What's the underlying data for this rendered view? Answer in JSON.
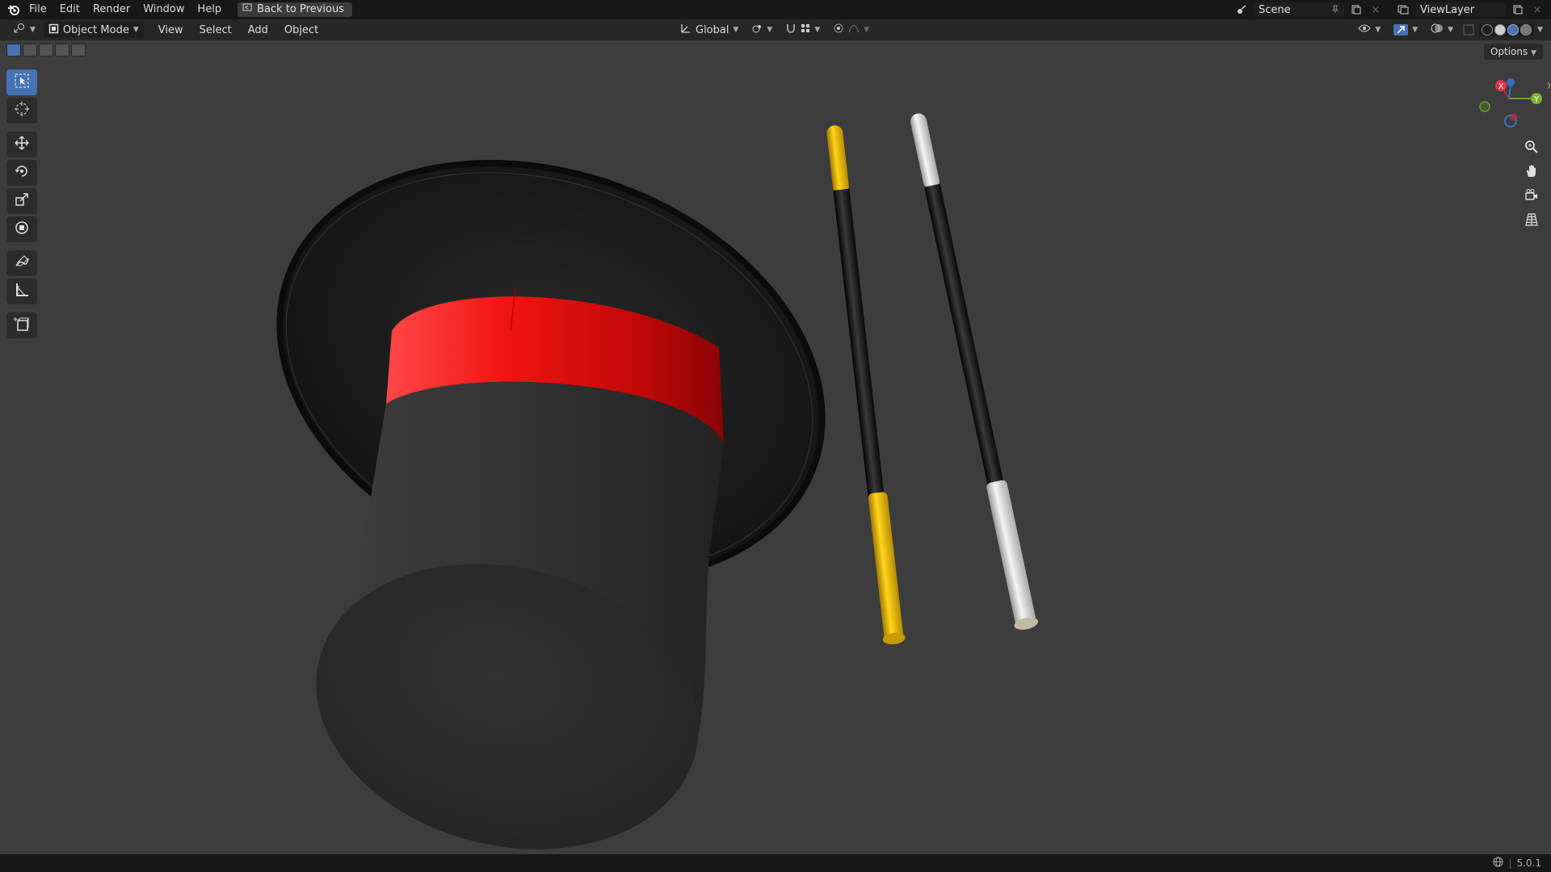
{
  "topbar": {
    "menus": [
      "File",
      "Edit",
      "Render",
      "Window",
      "Help"
    ],
    "back_label": "Back to Previous",
    "scene_name": "Scene",
    "view_layer": "ViewLayer"
  },
  "header": {
    "mode_label": "Object Mode",
    "menus": [
      "View",
      "Select",
      "Add",
      "Object"
    ],
    "transform_orientation": "Global"
  },
  "options_label": "Options",
  "gizmo": {
    "x": "X",
    "y": "Y"
  },
  "status": {
    "version": "5.0.1"
  },
  "colors": {
    "accent": "#4772b3",
    "hat_band": "#e01b1b",
    "wand_yellow": "#f0c419",
    "wand_white": "#e6e6e6"
  },
  "icons": [
    "blender-logo",
    "select-box-icon",
    "cursor-icon",
    "move-icon",
    "rotate-icon",
    "scale-icon",
    "transform-icon",
    "annotate-icon",
    "measure-icon",
    "add-cube-icon",
    "zoom-icon",
    "hand-icon",
    "camera-icon",
    "grid-icon"
  ]
}
